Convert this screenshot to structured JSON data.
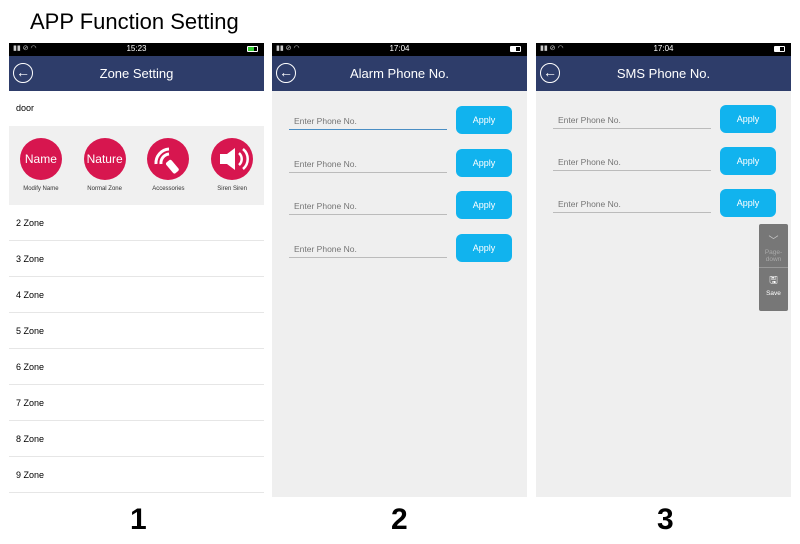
{
  "title": "APP Function Setting",
  "panels": [
    {
      "time": "15:23",
      "header": "Zone Setting",
      "door": "door",
      "icons": [
        {
          "text": "Name",
          "label": "Modify Name"
        },
        {
          "text": "Nature",
          "label": "Normal Zone"
        },
        {
          "text": "",
          "label": "Accessories",
          "icon": "remote-signal-icon"
        },
        {
          "text": "",
          "label": "Siren Siren",
          "icon": "speaker-icon"
        }
      ],
      "zones": [
        "2 Zone",
        "3 Zone",
        "4 Zone",
        "5 Zone",
        "6 Zone",
        "7 Zone",
        "8 Zone",
        "9 Zone"
      ],
      "number": "1"
    },
    {
      "time": "17:04",
      "header": "Alarm Phone No.",
      "placeholder": "Enter Phone No.",
      "apply": "Apply",
      "number": "2"
    },
    {
      "time": "17:04",
      "header": "SMS Phone No.",
      "placeholder": "Enter Phone No.",
      "apply": "Apply",
      "number": "3",
      "pagedown": "Page-down",
      "save": "Save"
    }
  ],
  "colors": {
    "header": "#2e3d6a",
    "accent": "#d7164f",
    "button": "#11b3ee"
  }
}
